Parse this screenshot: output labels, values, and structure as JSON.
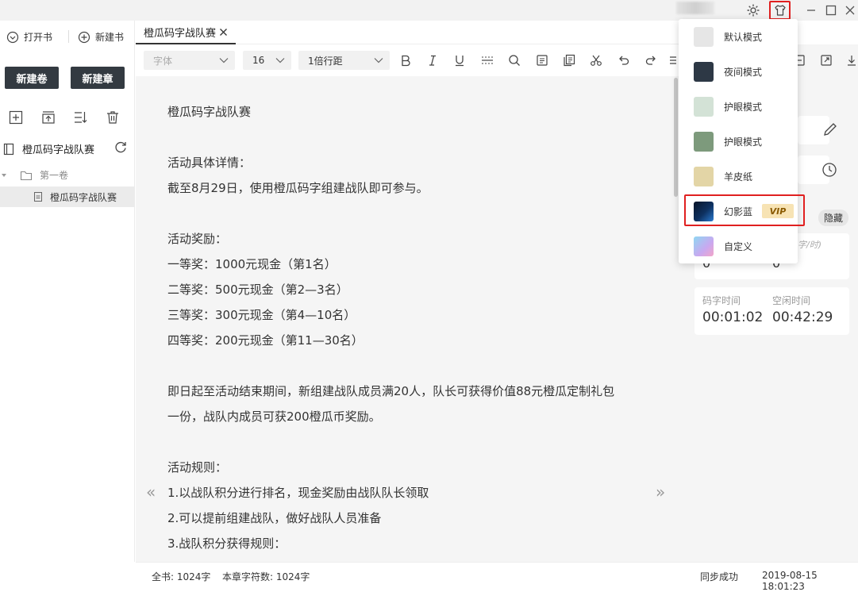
{
  "window": {
    "controls": {
      "settings": "gear-icon",
      "theme": "shirt-icon",
      "minimize": "minimize-icon",
      "maximize": "maximize-icon",
      "close": "close-icon"
    }
  },
  "sidebar": {
    "open_book": "打开书",
    "new_book": "新建书",
    "new_volume": "新建卷",
    "new_chapter": "新建章",
    "book_title": "橙瓜码字战队赛",
    "volume_name": "第一卷",
    "chapter_name": "橙瓜码字战队赛"
  },
  "tabs": [
    {
      "label": "橙瓜码字战队赛"
    }
  ],
  "toolbar": {
    "font_placeholder": "字体",
    "font_size": "16",
    "line_spacing": "1倍行距"
  },
  "editor": {
    "lines": [
      "橙瓜码字战队赛",
      "",
      "活动具体详情：",
      "截至8月29日，使用橙瓜码字组建战队即可参与。",
      "",
      "活动奖励：",
      "一等奖：1000元现金（第1名）",
      "二等奖：500元现金（第2—3名）",
      "三等奖：300元现金（第4—10名）",
      "四等奖：200元现金（第11—30名）",
      "",
      "即日起至活动结束期间，新组建战队成员满20人，队长可获得价值88元橙瓜定制礼包",
      "一份，战队内成员可获200橙瓜币奖励。",
      "",
      "活动规则：",
      "1.以战队积分进行排名，现金奖励由战队队长领取",
      "2.可以提前组建战队，做好战队人员准备",
      "3.战队积分获得规则："
    ]
  },
  "theme_menu": {
    "items": [
      {
        "label": "默认模式",
        "color": "#e6e6e6"
      },
      {
        "label": "夜间模式",
        "color": "#2d3845"
      },
      {
        "label": "护眼模式",
        "color": "#d3e2d6"
      },
      {
        "label": "护眼模式",
        "color": "#7d9a7c"
      },
      {
        "label": "羊皮纸",
        "color": "#e3d5a6"
      },
      {
        "label": "幻影蓝",
        "color": "#0c1e3a",
        "badge": "VIP"
      },
      {
        "label": "自定义",
        "color": "#c9a8f0"
      }
    ]
  },
  "right_panel": {
    "hide_label": "隐藏",
    "speed_unit": "字/时)",
    "stat_value_a": "0",
    "stat_value_b": "0",
    "typing_time_label": "码字时间",
    "typing_time": "00:01:02",
    "idle_time_label": "空闲时间",
    "idle_time": "00:42:29"
  },
  "status": {
    "total_words": "全书: 1024字",
    "chapter_words": "本章字符数: 1024字",
    "sync": "同步成功",
    "timestamp": "2019-08-15 18:01:23"
  },
  "colors": {
    "dark_button": "#333a41",
    "highlight": "#e02020",
    "vip": "#f7e3b4"
  }
}
